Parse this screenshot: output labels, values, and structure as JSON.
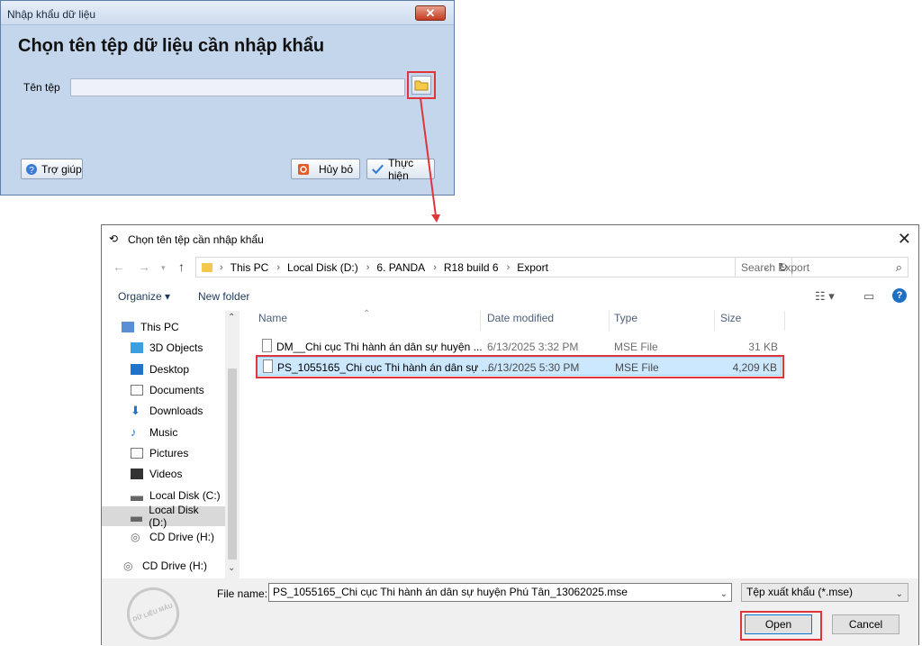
{
  "import_dialog": {
    "title": "Nhập khẩu dữ liệu",
    "heading": "Chọn tên tệp dữ liệu cần nhập khẩu",
    "file_label": "Tên tệp",
    "file_value": "",
    "help_label": "Trợ giúp",
    "cancel_label": "Hủy bỏ",
    "execute_label": "Thực hiện",
    "close_glyph": "✕"
  },
  "file_dialog": {
    "title": "Chọn tên tệp cần nhập khẩu",
    "close_glyph": "✕",
    "breadcrumb": [
      "This PC",
      "Local Disk (D:)",
      "6. PANDA",
      "R18 build 6",
      "Export"
    ],
    "search_placeholder": "Search Export",
    "toolbar": {
      "organize": "Organize ▾",
      "new_folder": "New folder"
    },
    "nav_items": [
      {
        "label": "This PC",
        "icon": "pc-icon"
      },
      {
        "label": "3D Objects",
        "icon": "cube-icon"
      },
      {
        "label": "Desktop",
        "icon": "desktop-icon"
      },
      {
        "label": "Documents",
        "icon": "documents-icon"
      },
      {
        "label": "Downloads",
        "icon": "download-icon"
      },
      {
        "label": "Music",
        "icon": "music-icon"
      },
      {
        "label": "Pictures",
        "icon": "pictures-icon"
      },
      {
        "label": "Videos",
        "icon": "video-icon"
      },
      {
        "label": "Local Disk (C:)",
        "icon": "disk-icon"
      },
      {
        "label": "Local Disk (D:)",
        "icon": "disk-icon",
        "selected": true
      },
      {
        "label": "CD Drive (H:)",
        "icon": "cd-icon"
      },
      {
        "label": "CD Drive (H:)",
        "icon": "cd-icon"
      }
    ],
    "columns": {
      "name": "Name",
      "date": "Date modified",
      "type": "Type",
      "size": "Size"
    },
    "files": [
      {
        "name": "DM__Chi cục Thi hành án dân sự huyện ...",
        "date": "6/13/2025 3:32 PM",
        "type": "MSE File",
        "size": "31 KB"
      },
      {
        "name": "PS_1055165_Chi cục Thi hành án dân sự ...",
        "date": "6/13/2025 5:30 PM",
        "type": "MSE File",
        "size": "4,209 KB",
        "selected": true
      }
    ],
    "filename_label": "File name:",
    "filename_value": "PS_1055165_Chi cục Thi hành án dân sự huyện Phú Tân_13062025.mse",
    "filetype": "Tệp xuất khẩu (*.mse)",
    "open_label": "Open",
    "cancel_label": "Cancel",
    "stamp_text": "DỮ LIỆU MẪU"
  },
  "colors": {
    "highlight": "#e0353b",
    "selection": "#cce8ff",
    "accent": "#0078d7"
  }
}
